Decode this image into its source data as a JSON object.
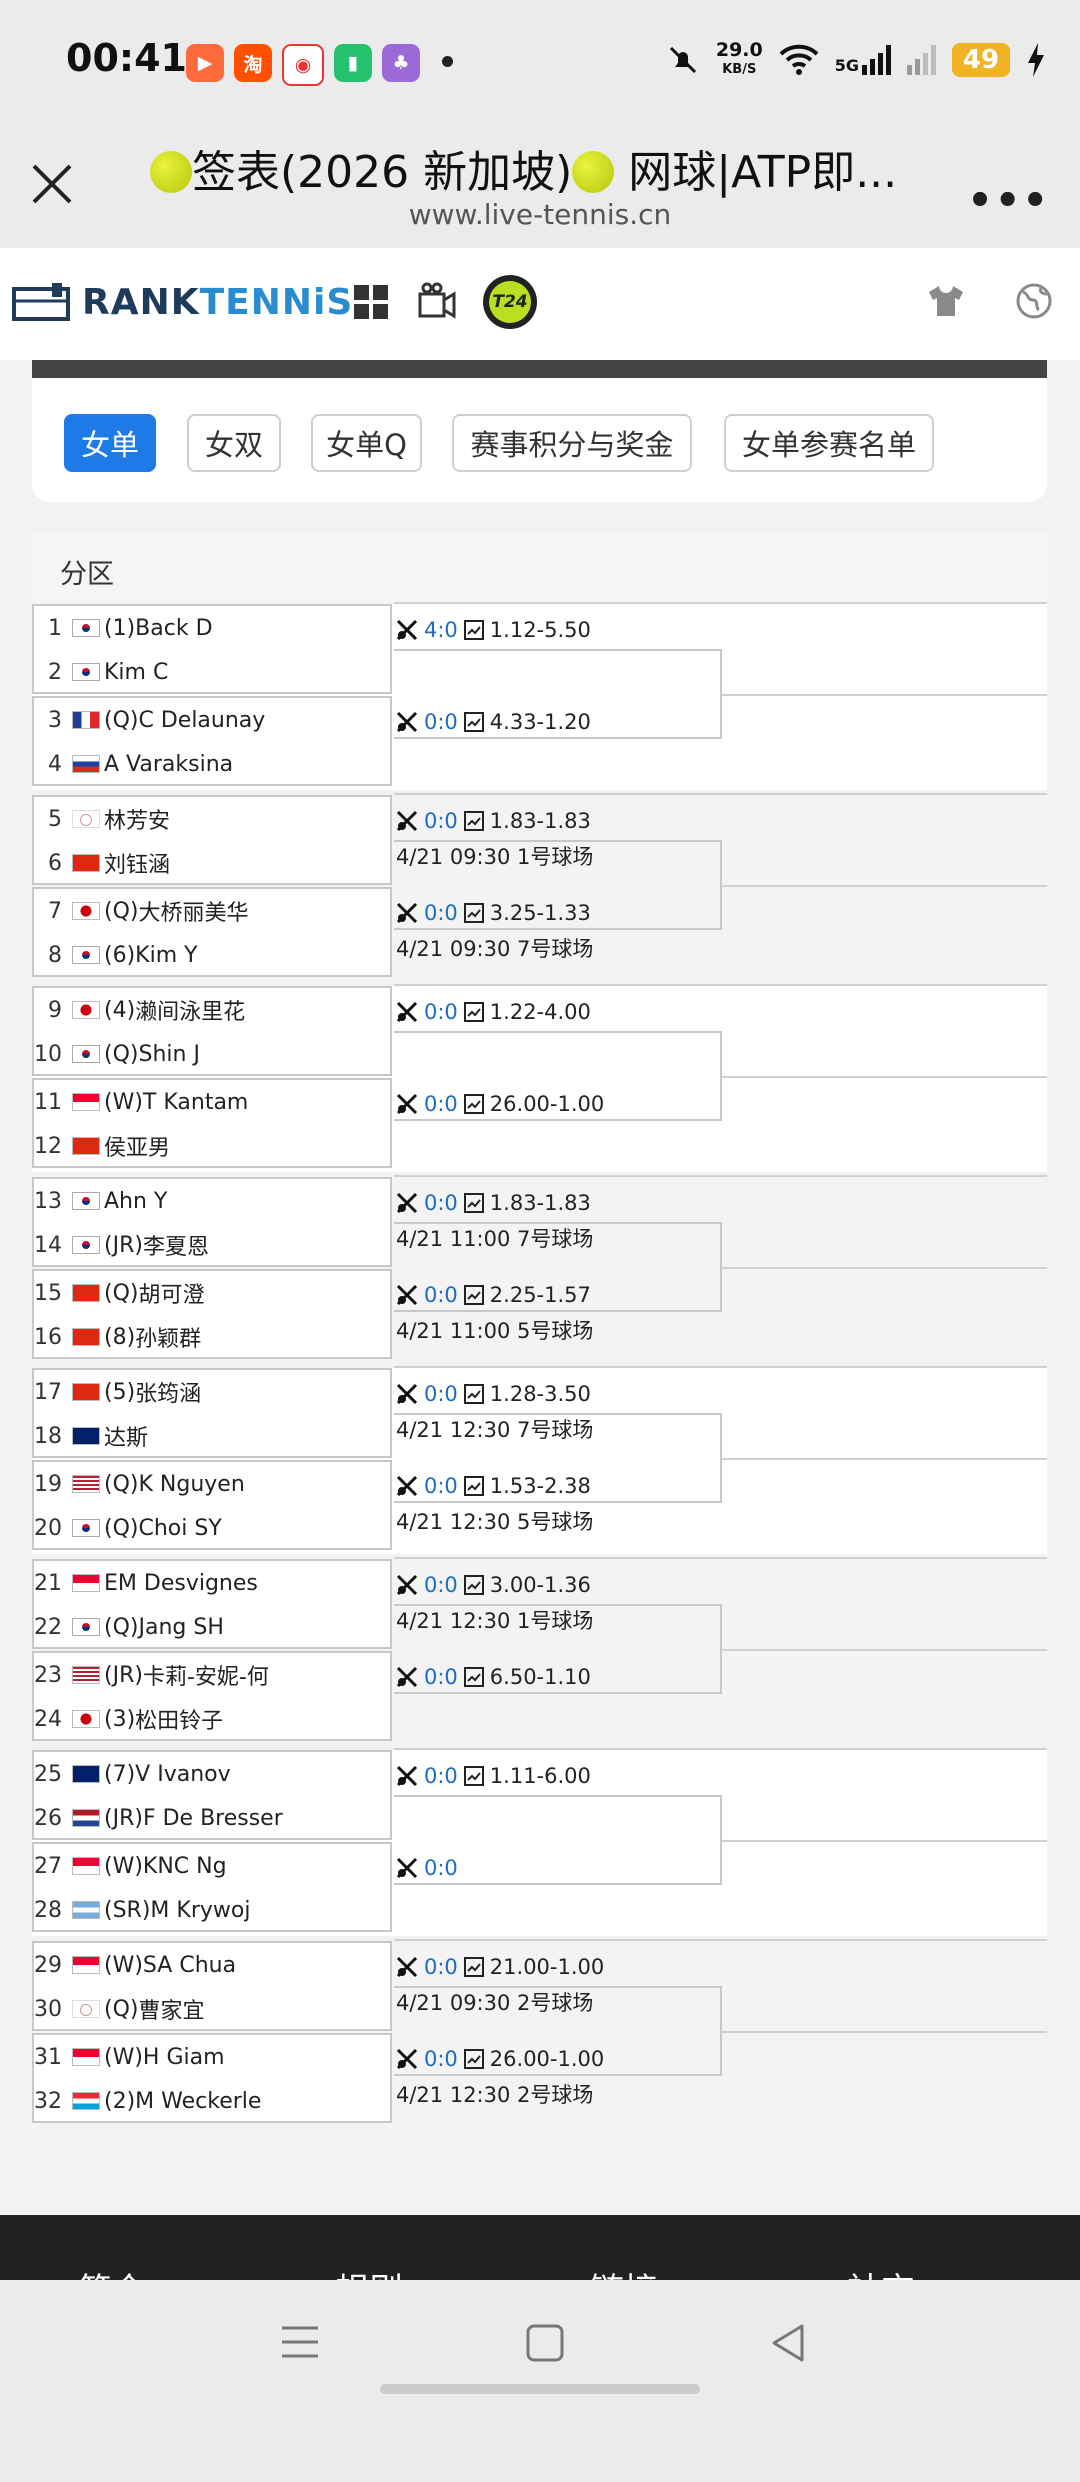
{
  "status_bar": {
    "time": "00:41",
    "net_speed": "29.0",
    "net_unit": "KB/S",
    "network": "5G",
    "battery": "49"
  },
  "page": {
    "title": "签表(2026 新加坡)",
    "title_rest": " 网球|ATP即...",
    "url": "www.live-tennis.cn"
  },
  "site": {
    "brand_a": "RANK",
    "brand_b": "TENNiS",
    "t24": "T24"
  },
  "tabs": [
    "女单",
    "女双",
    "女单Q",
    "赛事积分与奖金",
    "女单参赛名单"
  ],
  "draw_header": "分区",
  "groups": [
    {
      "players": [
        [
          "1",
          "(1)",
          "Back D",
          "kr"
        ],
        [
          "2",
          "",
          "Kim C",
          "kr"
        ],
        [
          "3",
          "(Q)",
          "C Delaunay",
          "fr"
        ],
        [
          "4",
          "",
          "A Varaksina",
          "ru"
        ]
      ],
      "matches": [
        {
          "score": "4:0",
          "odds": "1.12-5.50",
          "sched": ""
        },
        {
          "score": "0:0",
          "odds": "4.33-1.20",
          "sched": ""
        }
      ]
    },
    {
      "players": [
        [
          "5",
          "",
          "林芳安",
          "tw"
        ],
        [
          "6",
          "",
          "刘钰涵",
          "cn"
        ],
        [
          "7",
          "(Q)",
          "大桥丽美华",
          "jp"
        ],
        [
          "8",
          "(6)",
          "Kim Y",
          "kr"
        ]
      ],
      "matches": [
        {
          "score": "0:0",
          "odds": "1.83-1.83",
          "sched": "4/21 09:30 1号球场"
        },
        {
          "score": "0:0",
          "odds": "3.25-1.33",
          "sched": "4/21 09:30 7号球场"
        }
      ]
    },
    {
      "players": [
        [
          "9",
          "(4)",
          "濑间泳里花",
          "jp"
        ],
        [
          "10",
          "(Q)",
          "Shin J",
          "kr"
        ],
        [
          "11",
          "(W)",
          "T Kantam",
          "sg"
        ],
        [
          "12",
          "",
          "侯亚男",
          "cn"
        ]
      ],
      "matches": [
        {
          "score": "0:0",
          "odds": "1.22-4.00",
          "sched": ""
        },
        {
          "score": "0:0",
          "odds": "26.00-1.00",
          "sched": ""
        }
      ]
    },
    {
      "players": [
        [
          "13",
          "",
          "Ahn Y",
          "kr"
        ],
        [
          "14",
          "(JR)",
          "李夏恩",
          "kr"
        ],
        [
          "15",
          "(Q)",
          "胡可澄",
          "hk"
        ],
        [
          "16",
          "(8)",
          "孙颖群",
          "cn"
        ]
      ],
      "matches": [
        {
          "score": "0:0",
          "odds": "1.83-1.83",
          "sched": "4/21 11:00 7号球场"
        },
        {
          "score": "0:0",
          "odds": "2.25-1.57",
          "sched": "4/21 11:00 5号球场"
        }
      ]
    },
    {
      "players": [
        [
          "17",
          "(5)",
          "张筠涵",
          "cn"
        ],
        [
          "18",
          "",
          "达斯",
          "au"
        ],
        [
          "19",
          "(Q)",
          "K Nguyen",
          "us"
        ],
        [
          "20",
          "(Q)",
          "Choi SY",
          "kr"
        ]
      ],
      "matches": [
        {
          "score": "0:0",
          "odds": "1.28-3.50",
          "sched": "4/21 12:30 7号球场"
        },
        {
          "score": "0:0",
          "odds": "1.53-2.38",
          "sched": "4/21 12:30 5号球场"
        }
      ]
    },
    {
      "players": [
        [
          "21",
          "",
          "EM Desvignes",
          "sg"
        ],
        [
          "22",
          "(Q)",
          "Jang SH",
          "kr"
        ],
        [
          "23",
          "(JR)",
          "卡莉-安妮-何",
          "us"
        ],
        [
          "24",
          "(3)",
          "松田铃子",
          "jp"
        ]
      ],
      "matches": [
        {
          "score": "0:0",
          "odds": "3.00-1.36",
          "sched": "4/21 12:30 1号球场"
        },
        {
          "score": "0:0",
          "odds": "6.50-1.10",
          "sched": ""
        }
      ]
    },
    {
      "players": [
        [
          "25",
          "(7)",
          "V Ivanov",
          "au"
        ],
        [
          "26",
          "(JR)",
          "F De Bresser",
          "nl"
        ],
        [
          "27",
          "(W)",
          "KNC Ng",
          "sg"
        ],
        [
          "28",
          "(SR)",
          "M Krywoj",
          "ar"
        ]
      ],
      "matches": [
        {
          "score": "0:0",
          "odds": "1.11-6.00",
          "sched": ""
        },
        {
          "score": "0:0",
          "odds": "",
          "sched": ""
        }
      ]
    },
    {
      "players": [
        [
          "29",
          "(W)",
          "SA Chua",
          "sg"
        ],
        [
          "30",
          "(Q)",
          "曹家宜",
          "tw"
        ],
        [
          "31",
          "(W)",
          "H Giam",
          "sg"
        ],
        [
          "32",
          "(2)",
          "M Weckerle",
          "lu"
        ]
      ],
      "matches": [
        {
          "score": "0:0",
          "odds": "21.00-1.00",
          "sched": "4/21 09:30 2号球场"
        },
        {
          "score": "0:0",
          "odds": "26.00-1.00",
          "sched": "4/21 12:30 2号球场"
        }
      ]
    }
  ],
  "footer_links": [
    "简介",
    "规则",
    "链接",
    "社交"
  ],
  "colors": {
    "accent": "#1e7ae6",
    "score": "#1e6cc0",
    "brand": "#1f3b5b"
  }
}
